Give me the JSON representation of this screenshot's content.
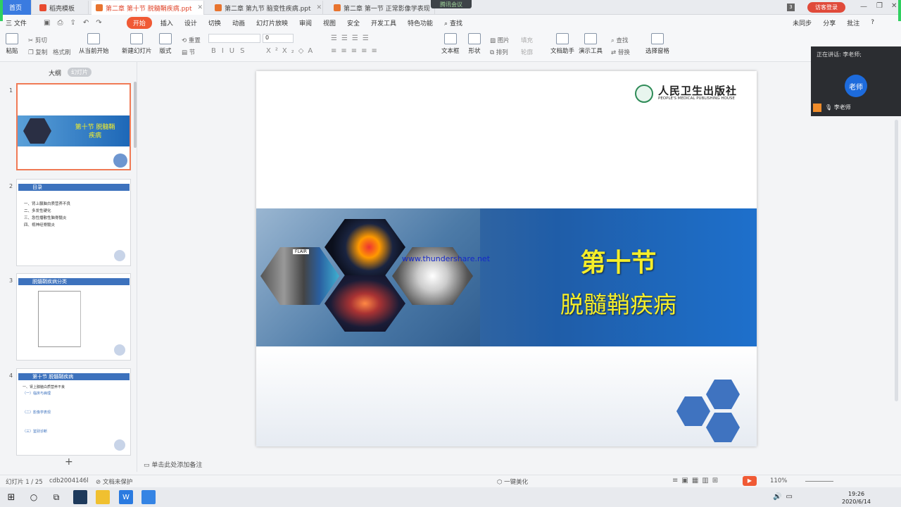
{
  "tabs": {
    "home": "首页",
    "items": [
      {
        "label": "稻壳模板",
        "icon_color": "#e84a2f"
      },
      {
        "label": "第二章 第十节 脱髓鞘疾病.ppt",
        "icon_color": "#e8742f"
      },
      {
        "label": "第二章 第九节 脑变性疾病.ppt",
        "icon_color": "#e8742f"
      },
      {
        "label": "第二章 第一节 正常影像学表现",
        "icon_color": "#e8742f"
      }
    ],
    "meeting_badge": "腾讯会议",
    "tab_count": "3",
    "visitor_login": "访客登录"
  },
  "menu": {
    "file": "三 文件",
    "items": [
      "开始",
      "插入",
      "设计",
      "切换",
      "动画",
      "幻灯片放映",
      "审阅",
      "视图",
      "安全",
      "开发工具",
      "特色功能"
    ],
    "active": "开始",
    "search": "查找",
    "sync": "未同步",
    "share": "分享",
    "comment": "批注"
  },
  "ribbon": {
    "paste": "粘贴",
    "cut": "剪切",
    "copy": "复制",
    "format_painter": "格式刷",
    "from_current": "从当前开始",
    "new_slide": "新建幻灯片",
    "layout": "版式",
    "section": "节",
    "reset": "重置",
    "font_size": "0",
    "text_box": "文本框",
    "shape": "形状",
    "picture": "图片",
    "fill": "填充",
    "arrange": "排列",
    "outline": "轮廓",
    "text_assistant": "文档助手",
    "presentation_tools": "演示工具",
    "find": "查找",
    "replace": "替换",
    "select_pane": "选择窗格"
  },
  "left_panel": {
    "tab_outline": "大纲",
    "tab_slides": "幻灯片",
    "thumbs": [
      {
        "num": "1",
        "title": "第十节 脱髓鞘疾病"
      },
      {
        "num": "2",
        "title": "目录",
        "lines": [
          "一、肾上腺脑白质营养不良",
          "二、多发性硬化",
          "三、急性播散性脑脊髓炎",
          "四、视神经脊髓炎"
        ]
      },
      {
        "num": "3",
        "title": "脱髓鞘疾病分类"
      },
      {
        "num": "4",
        "title": "第十节 脱髓鞘疾病",
        "lines": [
          "一、肾上腺脑白质营养不良",
          "（一）临床与病理",
          "（二）影像学表现",
          "（三）鉴别诊断"
        ]
      }
    ]
  },
  "slide": {
    "publisher_cn": "人民卫生出版社",
    "publisher_en": "PEOPLE'S MEDICAL PUBLISHING HOUSE",
    "watermark": "www.thundershare.net",
    "title_line1": "第十节",
    "title_line2": "脱髓鞘疾病",
    "tile_label": "FLAIR",
    "accent": "#f5ee2a"
  },
  "notes_placeholder": "单击此处添加备注",
  "status": {
    "slide_count": "幻灯片 1 / 25",
    "doc_id": "cdb2004146l",
    "protect": "文档未保护",
    "beautify": "一键美化",
    "zoom": "110%"
  },
  "meeting": {
    "speaking": "正在讲话: 李老师;",
    "avatar": "老师",
    "name": "李老师"
  },
  "taskbar": {
    "time": "19:26",
    "date": "2020/6/14"
  }
}
